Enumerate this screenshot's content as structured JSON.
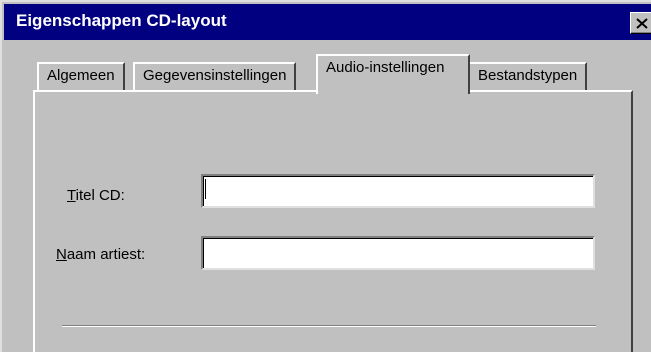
{
  "window": {
    "title": "Eigenschappen CD-layout"
  },
  "tabs": [
    {
      "label": "Algemeen",
      "active": false
    },
    {
      "label": "Gegevensinstellingen",
      "active": false
    },
    {
      "label": "Audio-instellingen",
      "active": true
    },
    {
      "label": "Bestandstypen",
      "active": false
    }
  ],
  "form": {
    "title_label_accel": "T",
    "title_label_rest": "itel CD:",
    "title_value": "",
    "artist_label_accel": "N",
    "artist_label_rest": "aam artiest:",
    "artist_value": ""
  },
  "icons": {
    "close": "close-icon"
  }
}
